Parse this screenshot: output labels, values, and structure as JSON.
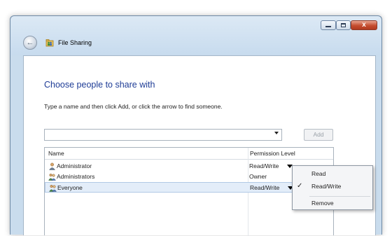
{
  "window": {
    "title": "File Sharing",
    "controls": {
      "minimize": "–",
      "maximize": "□",
      "close": "x"
    },
    "back_icon": "back-arrow-icon"
  },
  "main": {
    "heading": "Choose people to share with",
    "instruction": "Type a name and then click Add, or click the arrow to find someone.",
    "name_input": {
      "value": "",
      "placeholder": ""
    },
    "add_button": "Add"
  },
  "list": {
    "columns": [
      "Name",
      "Permission Level"
    ],
    "rows": [
      {
        "name": "Administrator",
        "permission": "Read/Write",
        "icon": "user-icon"
      },
      {
        "name": "Administrators",
        "permission": "Owner",
        "icon": "group-icon"
      },
      {
        "name": "Everyone",
        "permission": "Read/Write",
        "icon": "group-icon",
        "selected": true
      }
    ]
  },
  "context_menu": {
    "items": [
      {
        "label": "Read",
        "checked": false
      },
      {
        "label": "Read/Write",
        "checked": true
      },
      {
        "label": "Remove",
        "checked": false
      }
    ],
    "check_glyph": "✓"
  },
  "colors": {
    "heading": "#1e3c96",
    "window_frame": "#c9dced",
    "selection": "#e3edf9"
  }
}
